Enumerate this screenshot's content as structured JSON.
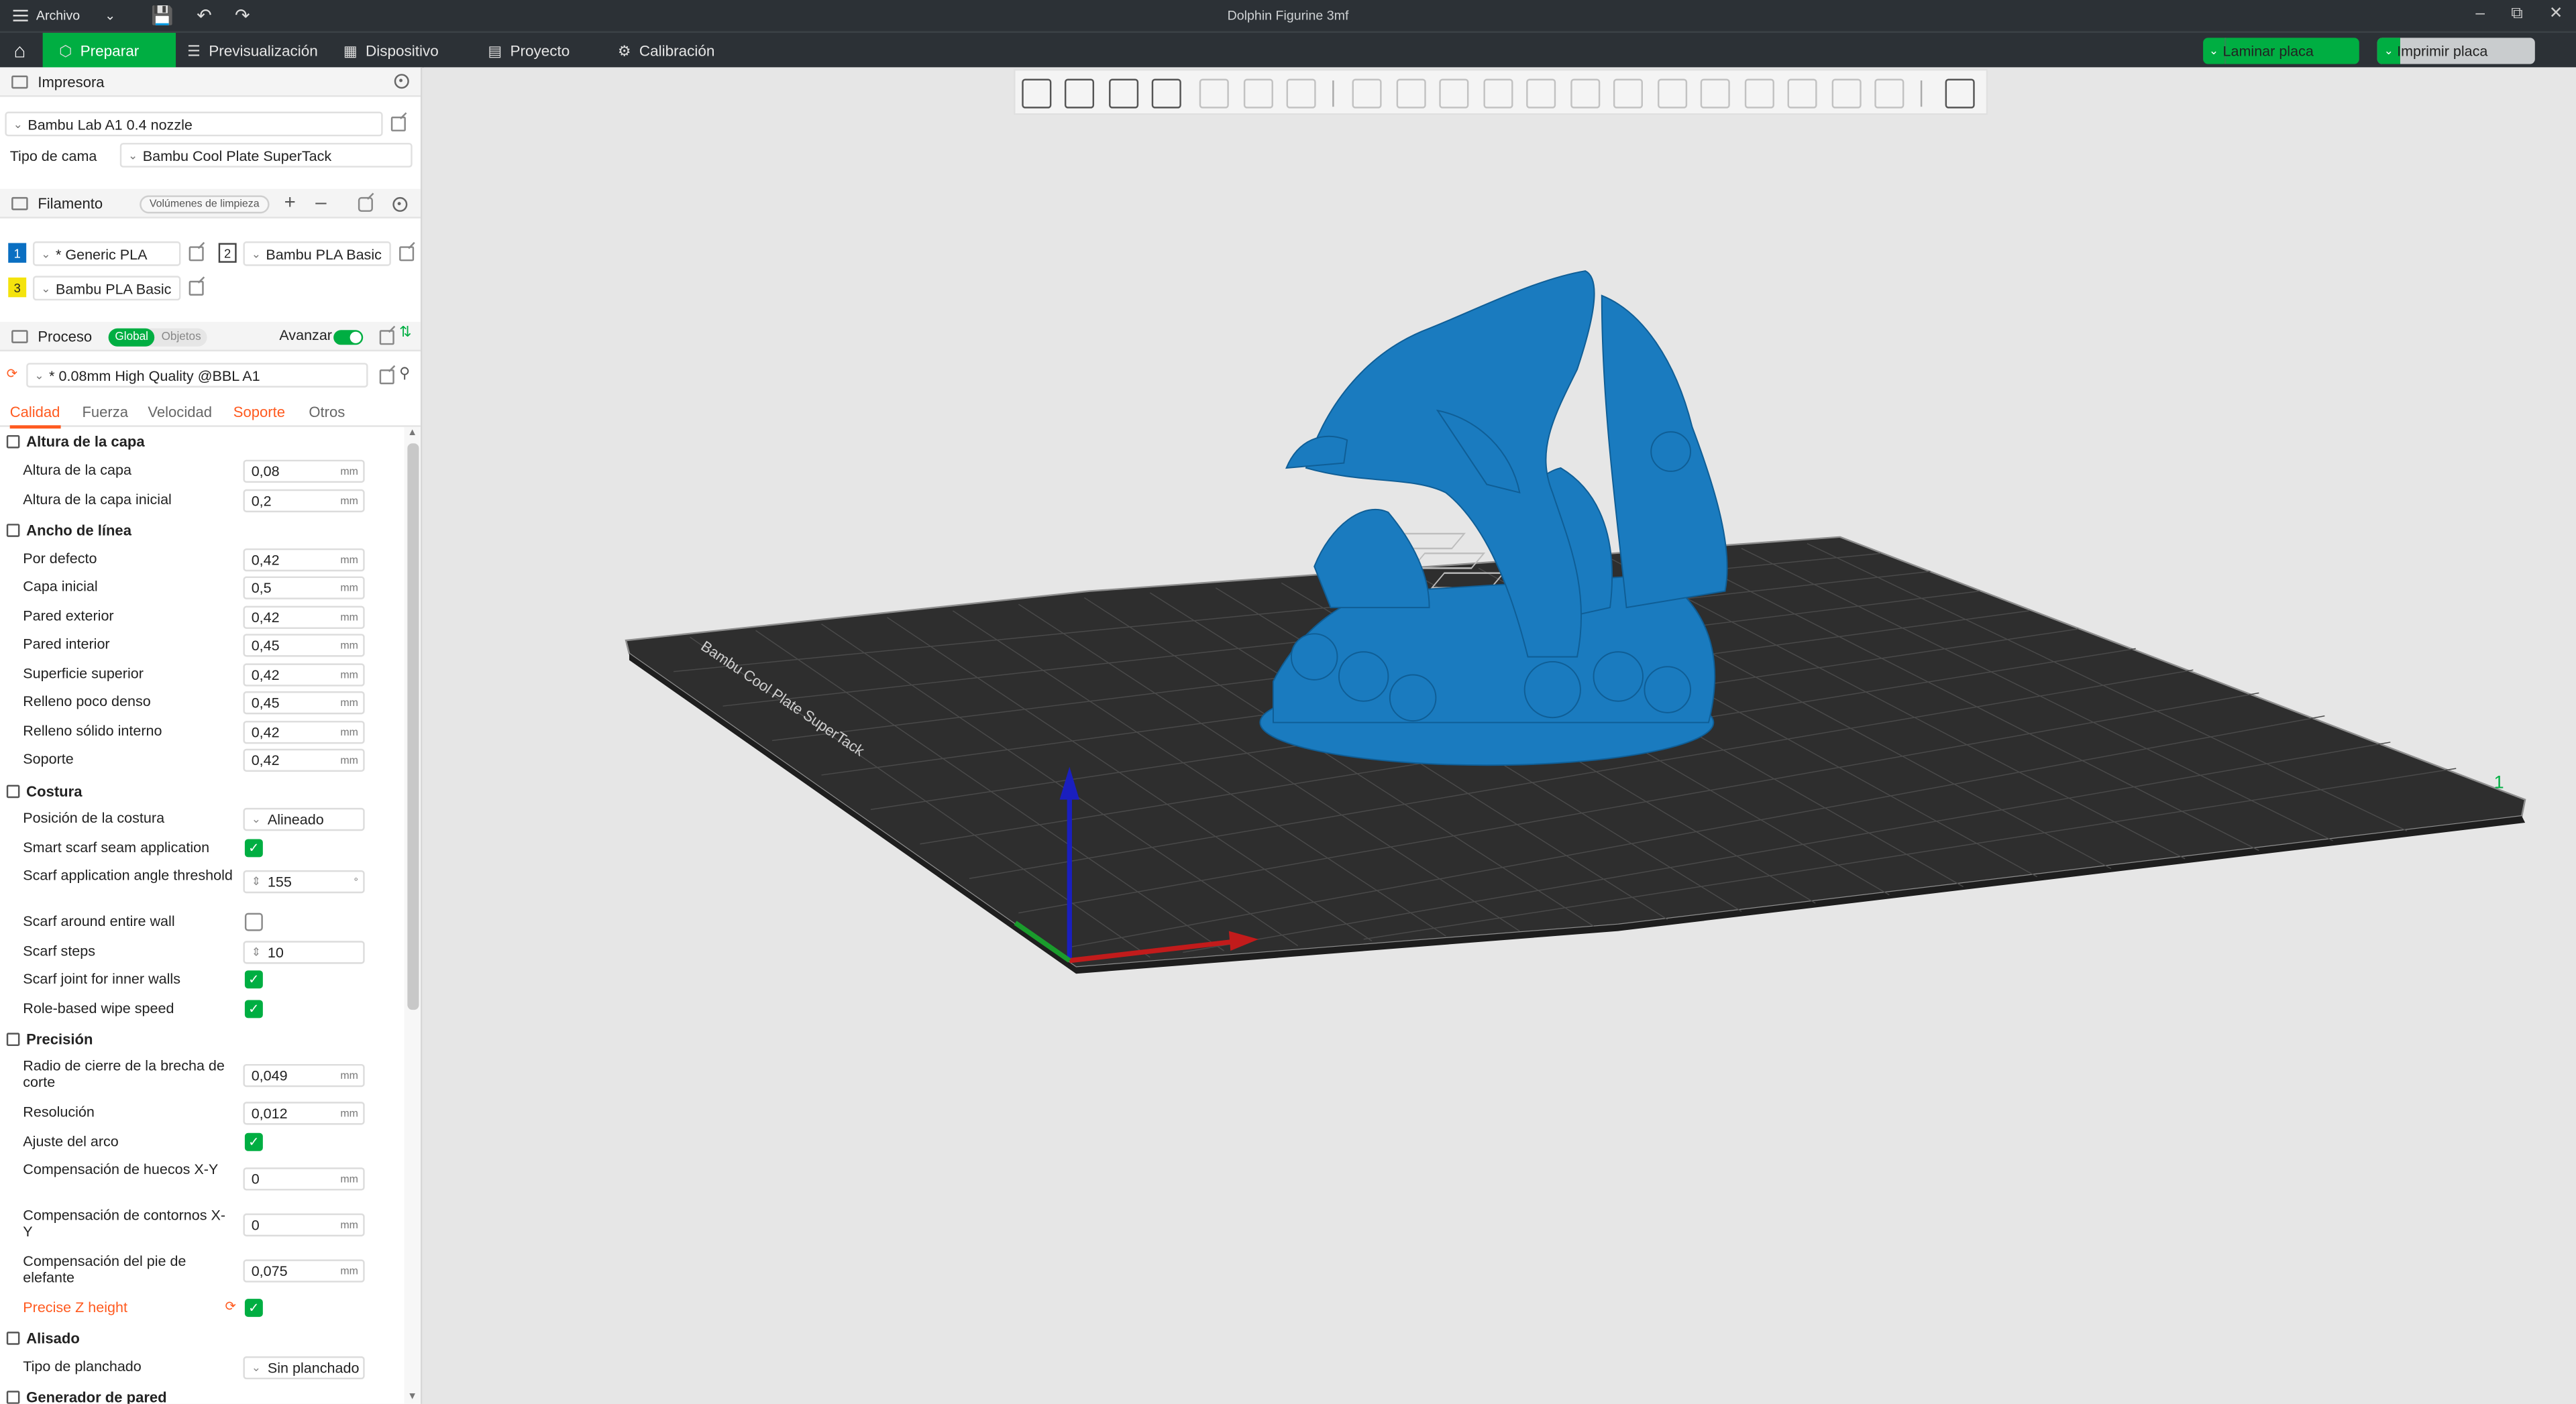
{
  "titlebar": {
    "menu_label": "Archivo",
    "document_title": "Dolphin Figurine 3mf",
    "quick_actions": [
      "save-icon",
      "undo-icon",
      "redo-icon"
    ]
  },
  "tabs": [
    {
      "label": "Preparar",
      "icon": "cube-icon",
      "active": true
    },
    {
      "label": "Previsualización",
      "icon": "layers-icon",
      "active": false
    },
    {
      "label": "Dispositivo",
      "icon": "device-icon",
      "active": false
    },
    {
      "label": "Proyecto",
      "icon": "project-icon",
      "active": false
    },
    {
      "label": "Calibración",
      "icon": "calibration-icon",
      "active": false
    }
  ],
  "actions": {
    "slice_label": "Laminar placa",
    "print_label": "Imprimir placa"
  },
  "printer": {
    "section_title": "Impresora",
    "printer_name": "Bambu Lab A1 0.4 nozzle",
    "bed_type_label": "Tipo de cama",
    "bed_type_value": "Bambu Cool Plate SuperTack"
  },
  "filament": {
    "section_title": "Filamento",
    "flush_label": "Volúmenes de limpieza",
    "slots": [
      {
        "index": "1",
        "name": "* Generic PLA",
        "color": "#0a6fc2"
      },
      {
        "index": "2",
        "name": "Bambu PLA Basic",
        "color": "#ffffff"
      },
      {
        "index": "3",
        "name": "Bambu PLA Basic",
        "color": "#f4e30d"
      }
    ]
  },
  "process": {
    "section_title": "Proceso",
    "toggle_global": "Global",
    "toggle_objects": "Objetos",
    "advanced_label": "Avanzar",
    "profile": "* 0.08mm High Quality @BBL A1",
    "subtabs": [
      "Calidad",
      "Fuerza",
      "Velocidad",
      "Soporte",
      "Otros"
    ]
  },
  "settings": {
    "layer_height_group": "Altura de la capa",
    "layer_height_label": "Altura de la capa",
    "layer_height_value": "0,08",
    "initial_layer_label": "Altura de la capa inicial",
    "initial_layer_value": "0,2",
    "line_width_group": "Ancho de línea",
    "default_label": "Por defecto",
    "default_value": "0,42",
    "first_layer_label": "Capa inicial",
    "first_layer_value": "0,5",
    "outer_wall_label": "Pared exterior",
    "outer_wall_value": "0,42",
    "inner_wall_label": "Pared interior",
    "inner_wall_value": "0,45",
    "top_surface_label": "Superficie superior",
    "top_surface_value": "0,42",
    "sparse_infill_label": "Relleno poco denso",
    "sparse_infill_value": "0,45",
    "solid_infill_label": "Relleno sólido interno",
    "solid_infill_value": "0,42",
    "support_label": "Soporte",
    "support_value": "0,42",
    "seam_group": "Costura",
    "seam_position_label": "Posición de la costura",
    "seam_position_value": "Alineado",
    "smart_scarf_label": "Smart scarf seam application",
    "scarf_angle_label": "Scarf application angle threshold",
    "scarf_angle_value": "155",
    "scarf_angle_unit": "°",
    "scarf_entire_label": "Scarf around entire wall",
    "scarf_steps_label": "Scarf steps",
    "scarf_steps_value": "10",
    "scarf_inner_label": "Scarf joint for inner walls",
    "role_wipe_label": "Role-based wipe speed",
    "precision_group": "Precisión",
    "slice_gap_label": "Radio de cierre de la brecha de corte",
    "slice_gap_value": "0,049",
    "resolution_label": "Resolución",
    "resolution_value": "0,012",
    "arc_fitting_label": "Ajuste del arco",
    "xy_hole_label": "Compensación de huecos X-Y",
    "xy_hole_value": "0",
    "xy_contour_label": "Compensación de contornos X-Y",
    "xy_contour_value": "0",
    "elephant_label": "Compensación del pie de elefante",
    "elephant_value": "0,075",
    "precise_z_label": "Precise Z height",
    "ironing_group": "Alisado",
    "ironing_type_label": "Tipo de planchado",
    "ironing_type_value": "Sin planchado",
    "wall_generator_group": "Generador de pared",
    "unit": "mm"
  },
  "scene": {
    "plate_label": "Bambu Cool Plate SuperTack",
    "plate_number": "1",
    "model_color": "#1a7bbf"
  }
}
